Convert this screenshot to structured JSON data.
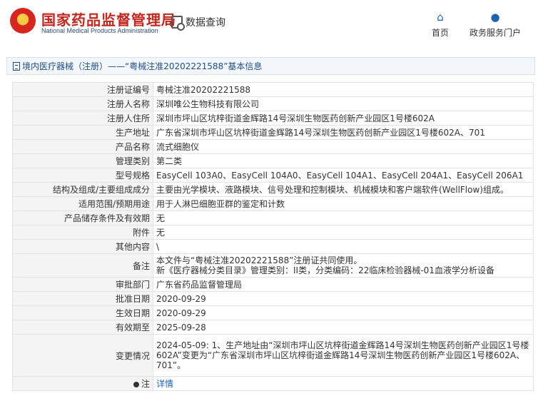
{
  "header": {
    "title_cn": "国家药品监督管理局",
    "title_en": "National Medical Products Administration",
    "query_label": "数据查询",
    "home_label": "首页",
    "service_label": "政务服务门户"
  },
  "breadcrumb": {
    "text": "境内医疗器械（注册）——“粤械注准20202221588”基本信息"
  },
  "rows": [
    {
      "label": "注册证编号",
      "value": "粤械注准20202221588"
    },
    {
      "label": "注册人名称",
      "value": "深圳唯公生物科技有限公司"
    },
    {
      "label": "注册人住所",
      "value": "深圳市坪山区坑梓街道金辉路14号深圳生物医药创新产业园区1号楼602A"
    },
    {
      "label": "生产地址",
      "value": "广东省深圳市坪山区坑梓街道金辉路14号深圳生物医药创新产业园区1号楼602A、701"
    },
    {
      "label": "产品名称",
      "value": "流式细胞仪"
    },
    {
      "label": "管理类别",
      "value": "第二类"
    },
    {
      "label": "型号规格",
      "value": "EasyCell 103A0、EasyCell 104A0、EasyCell 104A1、EasyCell 204A1、EasyCell 206A1"
    },
    {
      "label": "结构及组成/主要组成成分",
      "value": "主要由光学模块、液路模块、信号处理和控制模块、机械模块和客户端软件(WellFlow)组成。"
    },
    {
      "label": "适用范围/预期用途",
      "value": "用于人淋巴细胞亚群的鉴定和计数"
    },
    {
      "label": "产品储存条件及有效期",
      "value": "无"
    },
    {
      "label": "附件",
      "value": "无"
    },
    {
      "label": "其他内容",
      "value": "\\"
    },
    {
      "label": "备注",
      "value_line1": "本文件与“粤械注准20202221588”注册证共同使用。",
      "value_line2": "新《医疗器械分类目录》管理类别：II类，分类编码：22临床检验器械-01血液学分析设备"
    },
    {
      "label": "审批部门",
      "value": "广东省药品监督管理局"
    },
    {
      "label": "批准日期",
      "value": "2020-09-29"
    },
    {
      "label": "生效日期",
      "value": "2020-09-29"
    },
    {
      "label": "有效期至",
      "value": "2025-09-28"
    },
    {
      "label": "变更情况",
      "value": "2024-05-09: 1、生产地址由“深圳市坪山区坑梓街道金辉路14号深圳生物医药创新产业园区1号楼602A”变更为“广东省深圳市坪山区坑梓街道金辉路14号深圳生物医药创新产业园区1号楼602A、701”。"
    },
    {
      "label": "注",
      "value": "详情"
    }
  ]
}
